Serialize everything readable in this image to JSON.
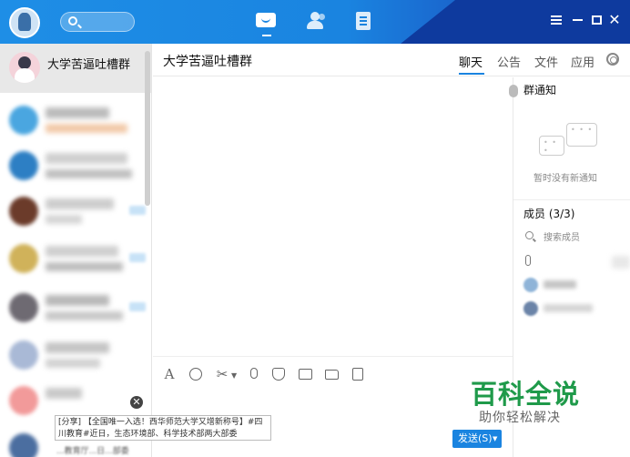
{
  "titlebar": {
    "search_placeholder": ""
  },
  "sidebar": {
    "active_chat": {
      "name": "大学苦逼吐槽群"
    }
  },
  "chat": {
    "title": "大学苦逼吐槽群",
    "tabs": {
      "chat": "聊天",
      "notice": "公告",
      "files": "文件",
      "apps": "应用"
    }
  },
  "right_panel": {
    "notice_title": "群通知",
    "notice_empty": "暂时没有新通知",
    "members_title": "成员 (3/3)",
    "member_search_placeholder": "搜索成员"
  },
  "share_popup": {
    "text": "[分享] 【全国唯一入选！西华师范大学又增新称号】#四川教育#近日，生态环境部、科学技术部两大部委",
    "below_text": "...教育厅...日...部委"
  },
  "composer": {
    "send_label": "发送(S)"
  },
  "watermark": {
    "main": "百科全说",
    "sub": "助你轻松解决"
  },
  "colors": {
    "accent": "#1a84e0",
    "titlebar_dark": "#0e3a9e",
    "watermark_green": "#1f9a4a"
  }
}
